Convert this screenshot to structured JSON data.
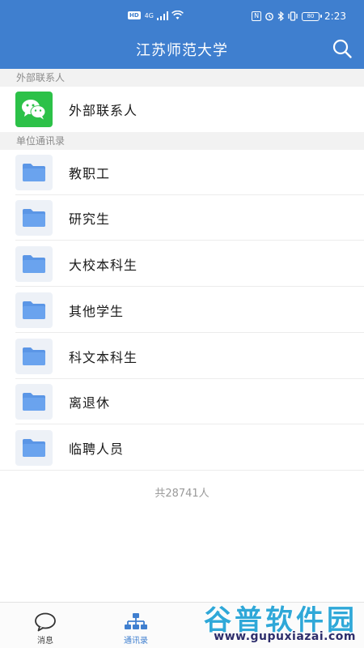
{
  "status_bar": {
    "hd_badge": "HD",
    "network": "4G",
    "nfc_badge": "N",
    "battery": "80",
    "time": "2:23"
  },
  "header": {
    "title": "江苏师范大学",
    "search_icon": "search-icon"
  },
  "sections": {
    "external": {
      "label": "外部联系人",
      "items": [
        {
          "label": "外部联系人",
          "icon": "wechat-icon"
        }
      ]
    },
    "directory": {
      "label": "单位通讯录",
      "items": [
        {
          "label": "教职工",
          "icon": "folder-icon"
        },
        {
          "label": "研究生",
          "icon": "folder-icon"
        },
        {
          "label": "大校本科生",
          "icon": "folder-icon"
        },
        {
          "label": "其他学生",
          "icon": "folder-icon"
        },
        {
          "label": "科文本科生",
          "icon": "folder-icon"
        },
        {
          "label": "离退休",
          "icon": "folder-icon"
        },
        {
          "label": "临聘人员",
          "icon": "folder-icon"
        }
      ]
    }
  },
  "total_count": "共28741人",
  "tabbar": {
    "tabs": [
      {
        "label": "消息",
        "icon": "chat-bubble-icon",
        "active": false
      },
      {
        "label": "通讯录",
        "icon": "org-chart-icon",
        "active": true
      }
    ]
  },
  "colors": {
    "header": "#3f7fcf",
    "wechat": "#2cc148",
    "folder": "#5b96e6",
    "active_tab": "#3f7fcf"
  },
  "watermark": {
    "main": "谷普软件园",
    "url": "www.gupuxiazai.com"
  }
}
